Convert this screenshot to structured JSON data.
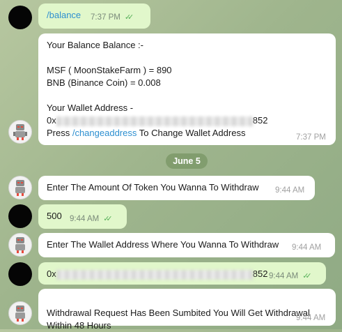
{
  "chat": {
    "date_chip": "June 5",
    "messages": [
      {
        "id": "m1",
        "sender": "user",
        "text": "/balance",
        "time": "7:37 PM"
      },
      {
        "id": "m2",
        "sender": "bot",
        "lines": [
          "Your Balance Balance :-",
          "",
          "MSF ( MoonStakeFarm ) =  890",
          "BNB (Binance Coin) = 0.008",
          "",
          "Your Wallet Address -"
        ],
        "address_prefix": "0x",
        "address_suffix": "852",
        "press_text": "Press ",
        "link_text": "/changeaddress",
        "press_suffix": " To Change Wallet Address",
        "time": "7:37 PM"
      },
      {
        "id": "m3",
        "sender": "bot",
        "text": "Enter The Amount Of Token You Wanna To Withdraw",
        "time": "9:44 AM"
      },
      {
        "id": "m4",
        "sender": "user",
        "text": "500",
        "time": "9:44 AM"
      },
      {
        "id": "m5",
        "sender": "bot",
        "text": "Enter The Wallet Address Where You Wanna To Withdraw",
        "time": "9:44 AM"
      },
      {
        "id": "m6",
        "sender": "user",
        "address_prefix": "0x",
        "address_suffix": "852",
        "time": "9:44 AM"
      },
      {
        "id": "m7",
        "sender": "bot",
        "text": "Withdrawal Request Has Been Sumbited You Will Get Withdrawal\nWithin 48 Hours",
        "time": "9:44 AM"
      }
    ]
  },
  "icons": {
    "read_receipt": "double-check-icon",
    "bot_avatar": "robot-avatar-icon"
  },
  "colors": {
    "outgoing_bubble": "#e1f7cb",
    "incoming_bubble": "#ffffff",
    "link": "#2d8fd0",
    "checks": "#56b058"
  }
}
